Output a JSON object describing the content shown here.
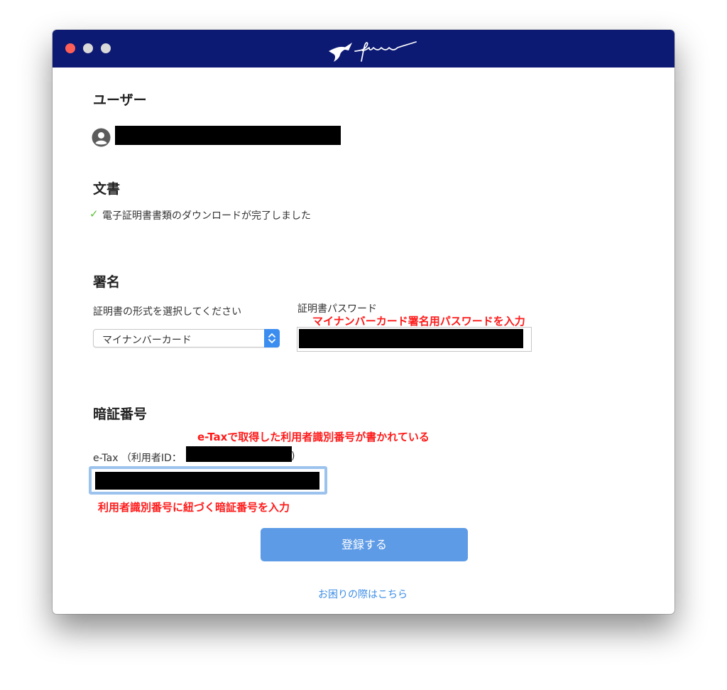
{
  "window": {
    "title_logo": "freee"
  },
  "user": {
    "heading": "ユーザー"
  },
  "document": {
    "heading": "文書",
    "status_check": "✓",
    "status_text": "電子証明書書類のダウンロードが完了しました"
  },
  "signature": {
    "heading": "署名",
    "format_label": "証明書の形式を選択してください",
    "format_value": "マイナンバーカード",
    "password_label": "証明書パスワード",
    "password_note": "マイナンバーカード署名用パスワードを入力"
  },
  "pin": {
    "heading": "暗証番号",
    "etax_label": "e-Tax （利用者ID：",
    "etax_label_close": ")",
    "etax_note": "e-Taxで取得した利用者識別番号が書かれている",
    "pin_note": "利用者識別番号に紐づく暗証番号を入力"
  },
  "actions": {
    "register_label": "登録する",
    "help_link": "お困りの際はこちら"
  },
  "colors": {
    "titlebar": "#0d1a73",
    "button": "#5e9be6",
    "annotation": "#ff1a1a",
    "link": "#3c8de6"
  }
}
